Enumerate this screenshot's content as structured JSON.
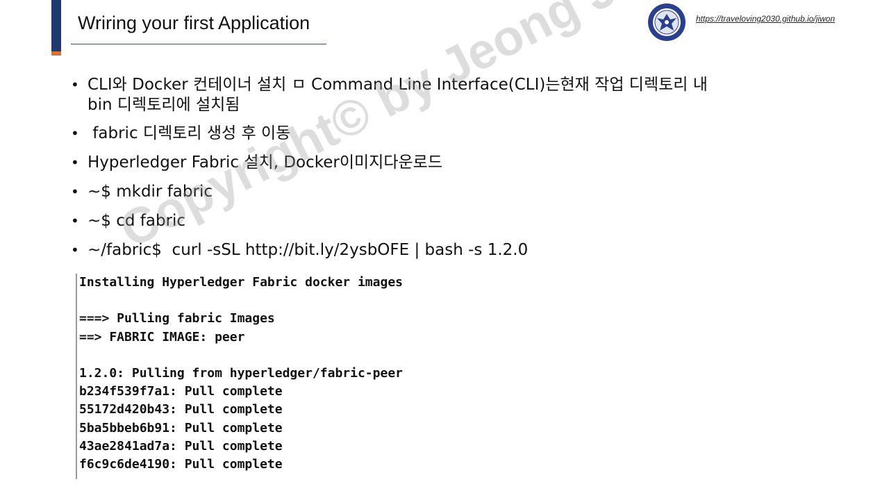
{
  "slide": {
    "title": "Wriring your first Application",
    "url": "https://traveloving2030.github.io/jiwon",
    "accent_color": "#1f3a6e",
    "accent_tip_color": "#e0702a"
  },
  "bullets": [
    {
      "line1": "CLI와 Docker 컨테이너 설치 ㅁ  Command Line Interface(CLI)는현재 작업 디렉토리 내",
      "line2": "bin 디렉토리에 설치됨"
    },
    {
      "line1": " fabric 디렉토리 생성 후 이동"
    },
    {
      "line1": "Hyperledger Fabric 설치, Docker이미지다운로드"
    },
    {
      "line1": "~$ mkdir fabric"
    },
    {
      "line1": "~$ cd fabric"
    },
    {
      "line1": "~/fabric$  curl -sSL http://bit.ly/2ysbOFE | bash -s 1.2.0"
    }
  ],
  "bullet_glyph": "•",
  "terminal": {
    "lines": [
      "Installing Hyperledger Fabric docker images",
      "",
      "===> Pulling fabric Images",
      "==> FABRIC IMAGE: peer",
      "",
      "1.2.0: Pulling from hyperledger/fabric-peer",
      "b234f539f7a1: Pull complete",
      "55172d420b43: Pull complete",
      "5ba5bbeb6b91: Pull complete",
      "43ae2841ad7a: Pull complete",
      "f6c9c6de4190: Pull complete"
    ]
  },
  "watermark": "Copyright© by Jeong JiWon"
}
